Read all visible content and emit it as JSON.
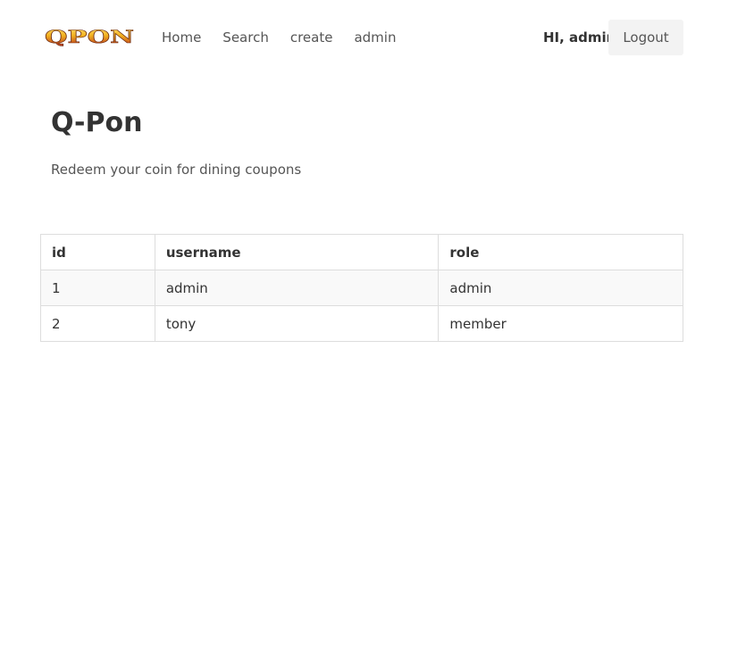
{
  "nav": {
    "logo_text": "QPON",
    "links": [
      "Home",
      "Search",
      "create",
      "admin"
    ],
    "greeting": "HI, admin",
    "logout_label": "Logout"
  },
  "hero": {
    "title": "Q-Pon",
    "subtitle": "Redeem your coin for dining coupons"
  },
  "table": {
    "headers": [
      "id",
      "username",
      "role"
    ],
    "rows": [
      [
        "1",
        "admin",
        "admin"
      ],
      [
        "2",
        "tony",
        "member"
      ]
    ]
  },
  "colors": {
    "logo_gold": "#f2b21f",
    "logo_red": "#b3261e",
    "logout_bg": "#f3f3f3",
    "row_stripe": "#f9f9f9",
    "border": "#dddddd"
  }
}
